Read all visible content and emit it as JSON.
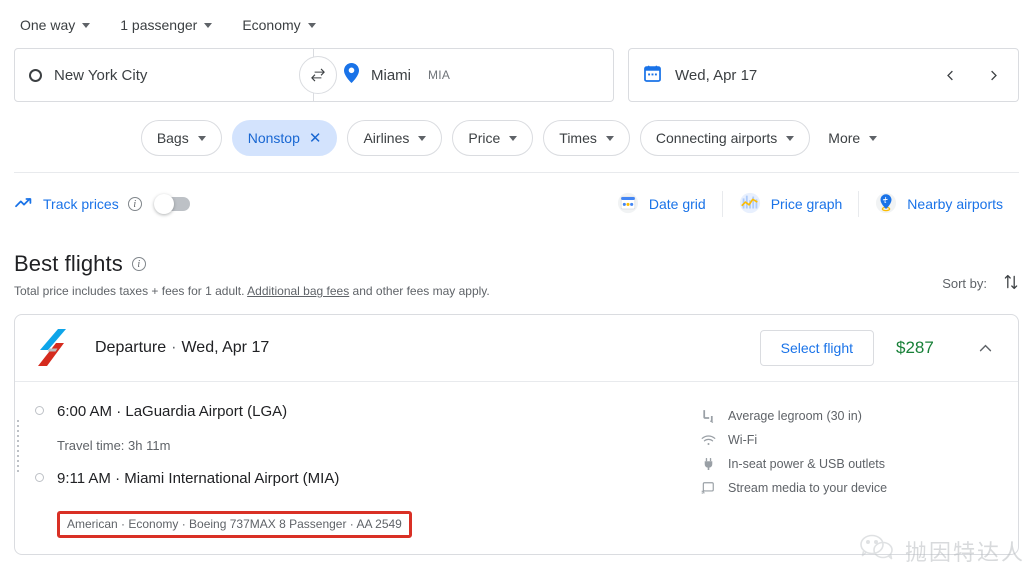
{
  "search": {
    "trip_type": "One way",
    "passengers": "1 passenger",
    "cabin_class": "Economy",
    "origin": "New York City",
    "destination": "Miami",
    "destination_code": "MIA",
    "date": "Wed, Apr 17"
  },
  "filters": [
    {
      "label": "Bags",
      "active": false,
      "caret": true
    },
    {
      "label": "Nonstop",
      "active": true,
      "caret": false
    },
    {
      "label": "Airlines",
      "active": false,
      "caret": true
    },
    {
      "label": "Price",
      "active": false,
      "caret": true
    },
    {
      "label": "Times",
      "active": false,
      "caret": true
    },
    {
      "label": "Connecting airports",
      "active": false,
      "caret": true
    },
    {
      "label": "More",
      "active": false,
      "caret": true
    }
  ],
  "tools": {
    "track_prices": "Track prices",
    "track_prices_toggle": "off",
    "date_grid": "Date grid",
    "price_graph": "Price graph",
    "nearby_airports": "Nearby airports"
  },
  "best_flights": {
    "title": "Best flights",
    "subtitle_before": "Total price includes taxes + fees for 1 adult. ",
    "subtitle_link": "Additional bag fees",
    "subtitle_after": " and other fees may apply.",
    "sort_by": "Sort by:"
  },
  "flight": {
    "header_label": "Departure",
    "header_date": "Wed, Apr 17",
    "select_button": "Select flight",
    "price": "$287",
    "depart_time_airport": "6:00 AM · LaGuardia Airport (LGA)",
    "travel_time": "Travel time: 3h 11m",
    "arrive_time_airport": "9:11 AM · Miami International Airport (MIA)",
    "meta": "American · Economy · Boeing 737MAX 8 Passenger · AA 2549",
    "amenities": [
      {
        "icon": "legroom-icon",
        "label": "Average legroom (30 in)"
      },
      {
        "icon": "wifi-icon",
        "label": "Wi-Fi"
      },
      {
        "icon": "power-outlet-icon",
        "label": "In-seat power & USB outlets"
      },
      {
        "icon": "cast-media-icon",
        "label": "Stream media to your device"
      }
    ]
  },
  "watermark": {
    "text": "抛因特达人"
  },
  "colors": {
    "accent_blue": "#1a73e8",
    "chip_active_bg": "#d3e3fd",
    "chip_active_text": "#1967d2",
    "price_green": "#188038",
    "highlight_red": "#d93025"
  }
}
